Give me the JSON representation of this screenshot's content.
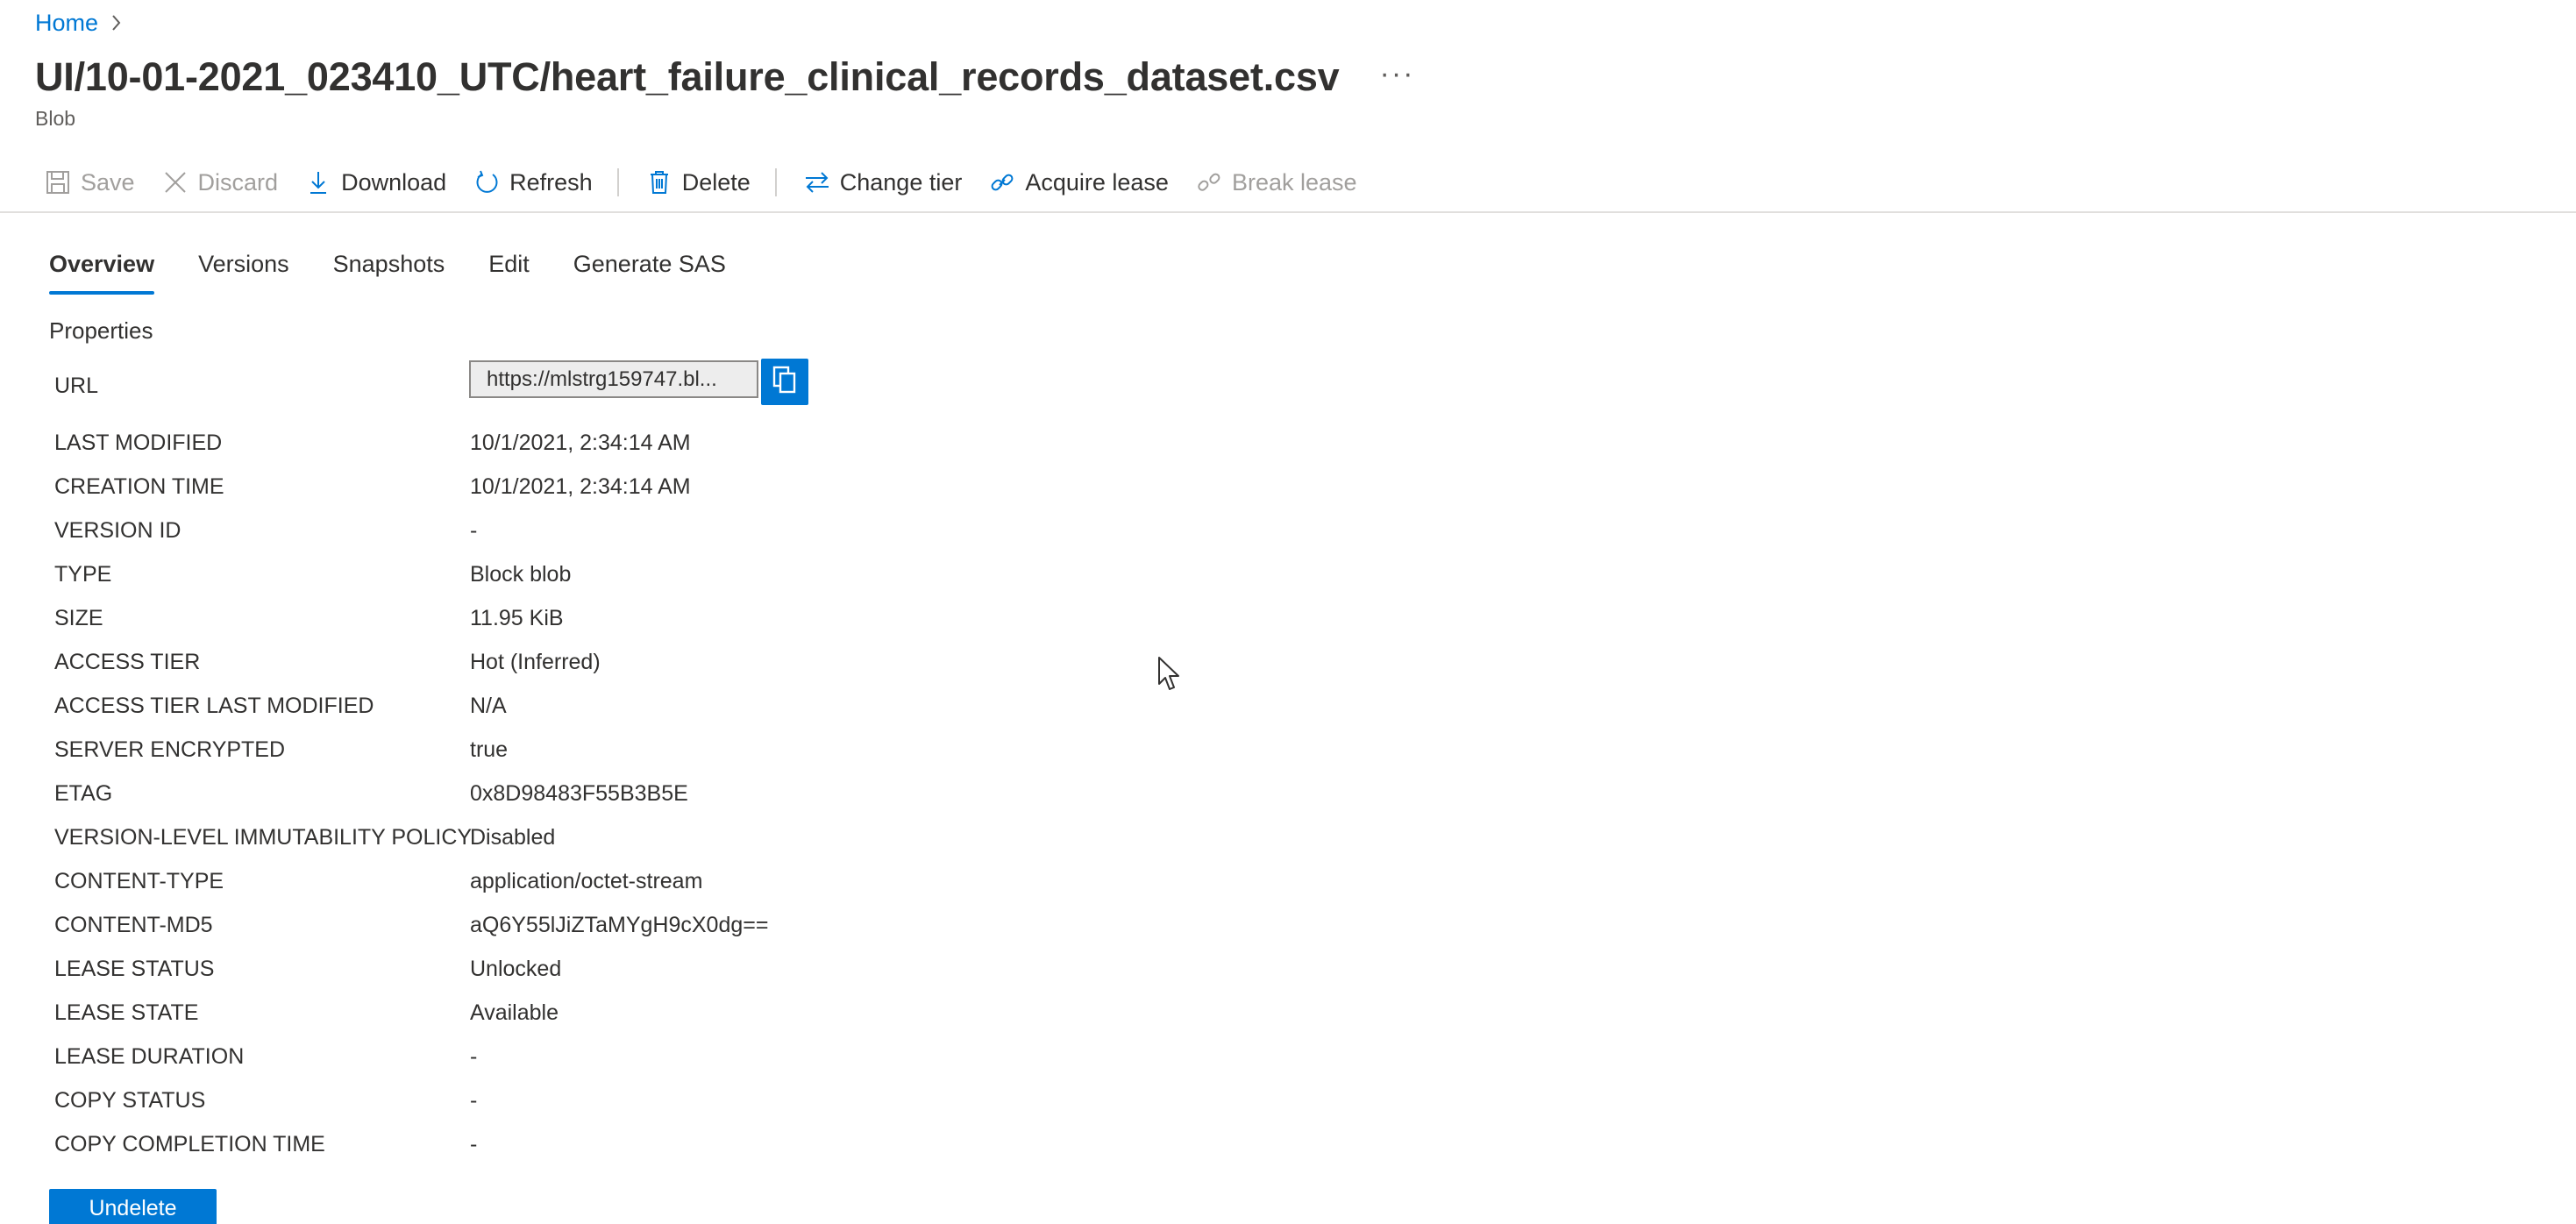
{
  "breadcrumb": {
    "home": "Home"
  },
  "title": "UI/10-01-2021_023410_UTC/heart_failure_clinical_records_dataset.csv",
  "more_label": "···",
  "subtitle": "Blob",
  "toolbar": {
    "save": "Save",
    "discard": "Discard",
    "download": "Download",
    "refresh": "Refresh",
    "delete": "Delete",
    "change_tier": "Change tier",
    "acquire_lease": "Acquire lease",
    "break_lease": "Break lease"
  },
  "tabs": [
    "Overview",
    "Versions",
    "Snapshots",
    "Edit",
    "Generate SAS"
  ],
  "active_tab": "Overview",
  "section_title": "Properties",
  "url": {
    "label": "URL",
    "value": "https://mlstrg159747.bl..."
  },
  "properties": [
    {
      "key": "LAST MODIFIED",
      "value": "10/1/2021, 2:34:14 AM"
    },
    {
      "key": "CREATION TIME",
      "value": "10/1/2021, 2:34:14 AM"
    },
    {
      "key": "VERSION ID",
      "value": "-"
    },
    {
      "key": "TYPE",
      "value": "Block blob"
    },
    {
      "key": "SIZE",
      "value": "11.95 KiB"
    },
    {
      "key": "ACCESS TIER",
      "value": "Hot (Inferred)"
    },
    {
      "key": "ACCESS TIER LAST MODIFIED",
      "value": "N/A"
    },
    {
      "key": "SERVER ENCRYPTED",
      "value": "true"
    },
    {
      "key": "ETAG",
      "value": "0x8D98483F55B3B5E"
    },
    {
      "key": "VERSION-LEVEL IMMUTABILITY POLICY",
      "value": "Disabled"
    },
    {
      "key": "CONTENT-TYPE",
      "value": "application/octet-stream"
    },
    {
      "key": "CONTENT-MD5",
      "value": "aQ6Y55lJiZTaMYgH9cX0dg=="
    },
    {
      "key": "LEASE STATUS",
      "value": "Unlocked"
    },
    {
      "key": "LEASE STATE",
      "value": "Available"
    },
    {
      "key": "LEASE DURATION",
      "value": "-"
    },
    {
      "key": "COPY STATUS",
      "value": "-"
    },
    {
      "key": "COPY COMPLETION TIME",
      "value": "-"
    }
  ],
  "undelete_label": "Undelete",
  "colors": {
    "accent": "#0078d4",
    "disabled": "#a19f9d",
    "text": "#323130"
  },
  "icons": [
    "chevron-right-icon",
    "save-icon",
    "discard-icon",
    "download-icon",
    "refresh-icon",
    "delete-icon",
    "change-tier-icon",
    "acquire-lease-icon",
    "break-lease-icon",
    "copy-icon",
    "mouse-cursor-icon"
  ]
}
